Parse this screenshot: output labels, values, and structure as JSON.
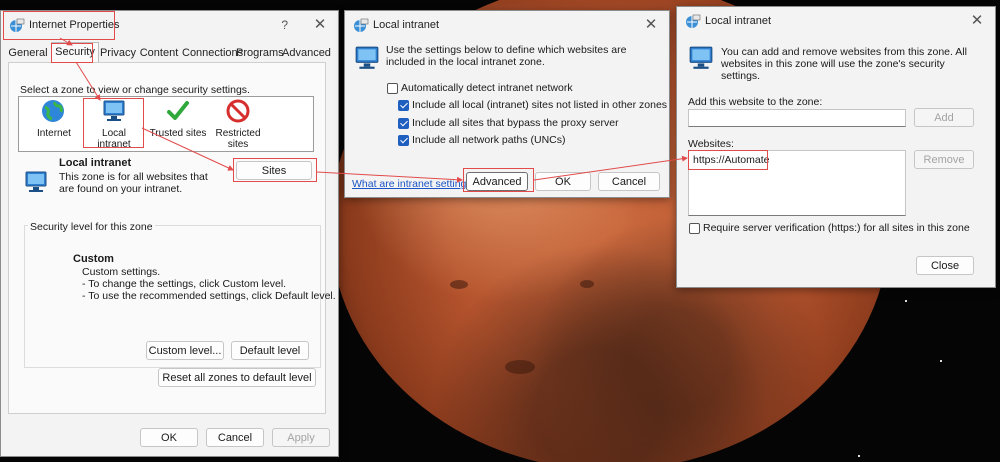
{
  "colors": {
    "accent": "#1f5fbf",
    "annotation_red": "#e14b4b",
    "dialog_bg": "#f3f3f3"
  },
  "internet_properties": {
    "title": "Internet Properties",
    "help": "?",
    "close": "✕",
    "tabs": [
      "General",
      "Security",
      "Privacy",
      "Content",
      "Connections",
      "Programs",
      "Advanced"
    ],
    "active_tab": "Security",
    "zone_prompt": "Select a zone to view or change security settings.",
    "zones": [
      {
        "label": "Internet",
        "icon": "globe-icon"
      },
      {
        "label": "Local intranet",
        "icon": "monitor-network-icon"
      },
      {
        "label": "Trusted sites",
        "icon": "checkmark-icon"
      },
      {
        "label": "Restricted sites",
        "icon": "no-entry-icon"
      }
    ],
    "selected_zone": {
      "name": "Local intranet",
      "description": "This zone is for all websites that are found on your intranet.",
      "sites_button": "Sites"
    },
    "security_level": {
      "group_title": "Security level for this zone",
      "level": "Custom",
      "lines": [
        "Custom settings.",
        "- To change the settings, click Custom level.",
        "- To use the recommended settings, click Default level."
      ],
      "custom_level_button": "Custom level...",
      "default_level_button": "Default level",
      "reset_button": "Reset all zones to default level"
    },
    "ok_button": "OK",
    "cancel_button": "Cancel",
    "apply_button": "Apply"
  },
  "local_intranet_1": {
    "title": "Local intranet",
    "close": "✕",
    "intro": "Use the settings below to define which websites are included in the local intranet zone.",
    "auto_detect": {
      "label": "Automatically detect intranet network",
      "checked": false
    },
    "options": [
      {
        "label": "Include all local (intranet) sites not listed in other zones",
        "checked": true
      },
      {
        "label": "Include all sites that bypass the proxy server",
        "checked": true
      },
      {
        "label": "Include all network paths (UNCs)",
        "checked": true
      }
    ],
    "link": "What are intranet settings?",
    "advanced_button": "Advanced",
    "ok_button": "OK",
    "cancel_button": "Cancel"
  },
  "local_intranet_2": {
    "title": "Local intranet",
    "close": "✕",
    "intro": "You can add and remove websites from this zone. All websites in this zone will use the zone's security settings.",
    "add_label": "Add this website to the zone:",
    "add_value": "",
    "add_button": "Add",
    "websites_label": "Websites:",
    "websites": [
      "https://Automate"
    ],
    "remove_button": "Remove",
    "require_https": {
      "label": "Require server verification (https:) for all sites in this zone",
      "checked": false
    },
    "close_button": "Close"
  }
}
